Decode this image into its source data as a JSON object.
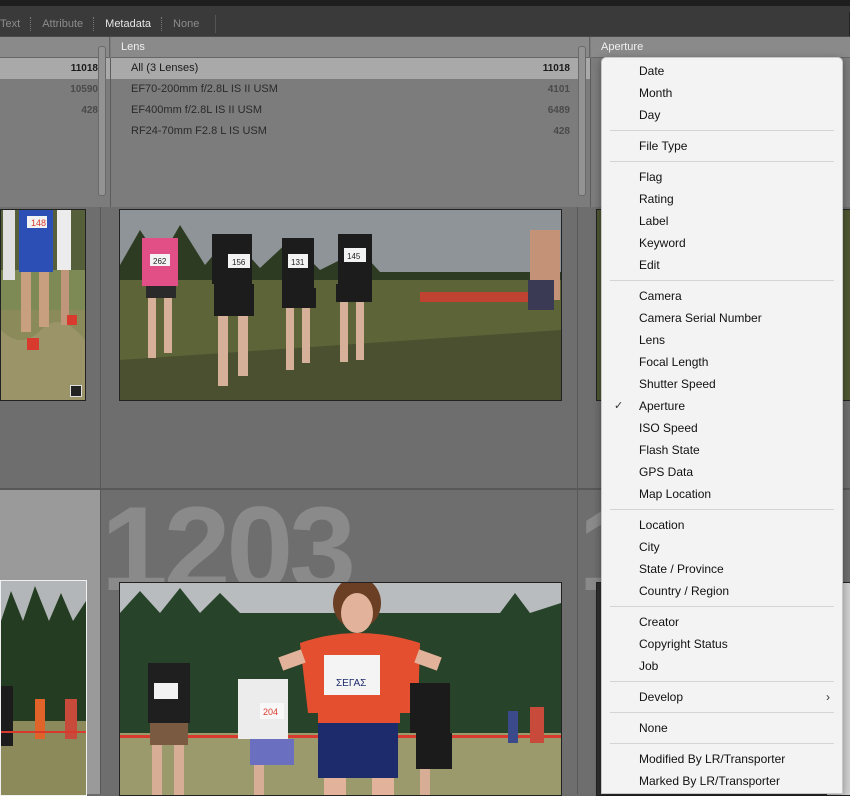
{
  "filter_bar": {
    "tabs": [
      {
        "label": "Text",
        "active": false
      },
      {
        "label": "Attribute",
        "active": false
      },
      {
        "label": "Metadata",
        "active": true
      },
      {
        "label": "None",
        "active": false
      }
    ]
  },
  "metadata_panel": {
    "left_column": {
      "rows": [
        {
          "label": "",
          "count": "11018",
          "selected": true
        },
        {
          "label": "",
          "count": "10590",
          "selected": false
        },
        {
          "label": "",
          "count": "428",
          "selected": false
        }
      ]
    },
    "lens_column": {
      "header": "Lens",
      "rows": [
        {
          "label": "All (3 Lenses)",
          "count": "11018",
          "selected": true
        },
        {
          "label": "EF70-200mm f/2.8L IS II USM",
          "count": "4101",
          "selected": false
        },
        {
          "label": "EF400mm f/2.8L IS II USM",
          "count": "6489",
          "selected": false
        },
        {
          "label": "RF24-70mm F2.8 L IS USM",
          "count": "428",
          "selected": false
        }
      ]
    },
    "aperture_column": {
      "header": "Aperture"
    }
  },
  "grid": {
    "cell_number_1": "1203",
    "cell_number_2": "1"
  },
  "colors": {
    "menu_bg": "#f3f3f3",
    "panel_bg": "#7c7c7c",
    "grid_bg": "#585858",
    "bib_red": "#d93a2e"
  },
  "context_menu": {
    "groups": [
      [
        {
          "label": "Date"
        },
        {
          "label": "Month"
        },
        {
          "label": "Day"
        }
      ],
      [
        {
          "label": "File Type"
        }
      ],
      [
        {
          "label": "Flag"
        },
        {
          "label": "Rating"
        },
        {
          "label": "Label"
        },
        {
          "label": "Keyword"
        },
        {
          "label": "Edit"
        }
      ],
      [
        {
          "label": "Camera"
        },
        {
          "label": "Camera Serial Number"
        },
        {
          "label": "Lens"
        },
        {
          "label": "Focal Length"
        },
        {
          "label": "Shutter Speed"
        },
        {
          "label": "Aperture",
          "checked": true
        },
        {
          "label": "ISO Speed"
        },
        {
          "label": "Flash State"
        },
        {
          "label": "GPS Data"
        },
        {
          "label": "Map Location"
        }
      ],
      [
        {
          "label": "Location"
        },
        {
          "label": "City"
        },
        {
          "label": "State / Province"
        },
        {
          "label": "Country / Region"
        }
      ],
      [
        {
          "label": "Creator"
        },
        {
          "label": "Copyright Status"
        },
        {
          "label": "Job"
        }
      ],
      [
        {
          "label": "Develop",
          "submenu": true
        }
      ],
      [
        {
          "label": "None"
        }
      ],
      [
        {
          "label": "Modified By LR/Transporter"
        },
        {
          "label": "Marked By LR/Transporter"
        }
      ]
    ],
    "check_glyph": "✓",
    "submenu_glyph": "›"
  },
  "photo_text": {
    "bib_148": "148",
    "bib_262": "262",
    "bib_156": "156",
    "bib_131": "131",
    "bib_145": "145",
    "bib_204": "204",
    "bib_main": "ΣΕΓΑΣ"
  }
}
